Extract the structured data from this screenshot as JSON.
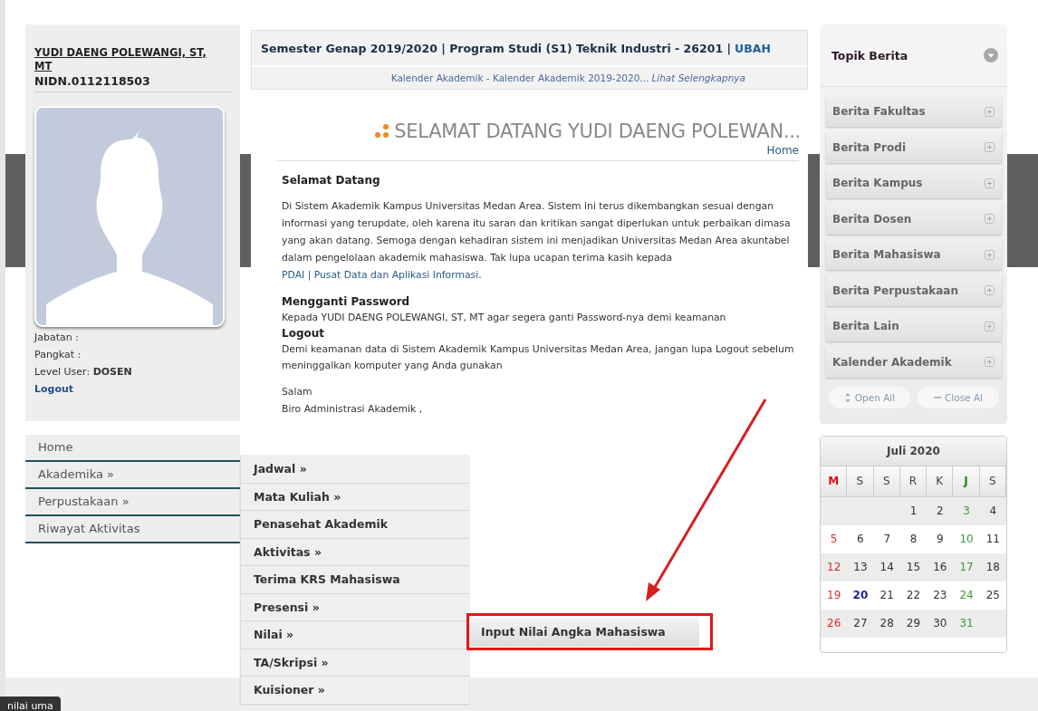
{
  "profile": {
    "name": "YUDI DAENG POLEWANGI, ST, MT",
    "nidn": "NIDN.0112118503",
    "info": [
      "Jabatan :",
      "Pangkat :",
      "Level User: **DOSEN**"
    ],
    "logout": "Logout"
  },
  "menu": [
    "Home",
    "Akademika »",
    "Perpustakaan »",
    "Riwayat Aktivitas"
  ],
  "submenu": [
    "Jadwal »",
    "Mata Kuliah »",
    "Penasehat Akademik",
    "Aktivitas »",
    "Terima KRS Mahasiswa",
    "Presensi »",
    "Nilai »",
    "TA/Skripsi »",
    "Kuisioner »"
  ],
  "flyout": {
    "label": "Input Nilai Angka Mahasiswa",
    "highlighted": true,
    "pointed": true
  },
  "header": {
    "info": "Semester Genap 2019/2020 | Program Studi (S1) Teknik Industri - 26201 |",
    "action": "UBAH",
    "announcement": "Kalender Akademik - Kalender Akademik 2019-2020...",
    "more": "Lihat Selengkapnya"
  },
  "welcome": {
    "title": "SELAMAT DATANG YUDI DAENG POLEWAN...",
    "breadcrumb": "Home",
    "sections": [
      {
        "heading": "Selamat Datang",
        "kind": "intro",
        "text": "Di Sistem Akademik Kampus Universitas Medan Area. Sistem ini terus dikembangkan sesuai dengan informasi yang terupdate, oleh karena itu saran dan kritikan sangat diperlukan untuk perbaikan dimasa yang akan datang. Semoga dengan kehadiran sistem ini menjadikan Universitas Medan Area akuntabel dalam pengelolaan akademik mahasiswa. Tak lupa ucapan terima kasih kepada",
        "link": "PDAI | Pusat Data dan Aplikasi Informasi",
        "end": "."
      },
      {
        "heading": "Mengganti Password",
        "kind": "note",
        "text": "Kepada YUDI DAENG POLEWANGI, ST, MT agar segera ganti Password-nya demi keamanan"
      },
      {
        "heading": "Logout",
        "kind": "note",
        "text": "Demi keamanan data di Sistem Akademik Kampus Universitas Medan Area, jangan lupa Logout sebelum meninggalkan komputer yang Anda gunakan"
      }
    ],
    "closing": [
      "Salam",
      "Biro Administrasi Akademik ,"
    ]
  },
  "news": {
    "title": "Topik Berita",
    "topics": [
      {
        "label": "Berita Fakultas",
        "expanded": false
      },
      {
        "label": "Berita Prodi",
        "expanded": false
      },
      {
        "label": "Berita Kampus",
        "expanded": false
      },
      {
        "label": "Berita Dosen",
        "expanded": false
      },
      {
        "label": "Berita Mahasiswa",
        "expanded": false
      },
      {
        "label": "Berita Perpustakaan",
        "expanded": false
      },
      {
        "label": "Berita Lain",
        "expanded": false
      },
      {
        "label": "Kalender Akademik",
        "expanded": false
      }
    ],
    "buttons": [
      {
        "kind": "open",
        "label": "Open All"
      },
      {
        "kind": "close",
        "label": "Close Al"
      }
    ]
  },
  "calendar": {
    "title": "Juli 2020",
    "weekdays": [
      {
        "label": "M",
        "kind": "sunday"
      },
      {
        "label": "S",
        "kind": "normal"
      },
      {
        "label": "S",
        "kind": "normal"
      },
      {
        "label": "R",
        "kind": "normal"
      },
      {
        "label": "K",
        "kind": "normal"
      },
      {
        "label": "J",
        "kind": "friday"
      },
      {
        "label": "S",
        "kind": "normal"
      }
    ],
    "weeks": [
      [
        {
          "kind": "empty"
        },
        {
          "kind": "empty"
        },
        {
          "kind": "empty"
        },
        {
          "day": "1",
          "kind": "normal"
        },
        {
          "day": "2",
          "kind": "normal"
        },
        {
          "day": "3",
          "kind": "friday"
        },
        {
          "day": "4",
          "kind": "normal"
        }
      ],
      [
        {
          "day": "5",
          "kind": "sunday"
        },
        {
          "day": "6",
          "kind": "normal"
        },
        {
          "day": "7",
          "kind": "normal"
        },
        {
          "day": "8",
          "kind": "normal"
        },
        {
          "day": "9",
          "kind": "normal"
        },
        {
          "day": "10",
          "kind": "friday"
        },
        {
          "day": "11",
          "kind": "normal"
        }
      ],
      [
        {
          "day": "12",
          "kind": "sunday"
        },
        {
          "day": "13",
          "kind": "normal"
        },
        {
          "day": "14",
          "kind": "normal"
        },
        {
          "day": "15",
          "kind": "normal"
        },
        {
          "day": "16",
          "kind": "normal"
        },
        {
          "day": "17",
          "kind": "friday"
        },
        {
          "day": "18",
          "kind": "normal"
        }
      ],
      [
        {
          "day": "19",
          "kind": "sunday"
        },
        {
          "day": "20",
          "kind": "today"
        },
        {
          "day": "21",
          "kind": "normal"
        },
        {
          "day": "22",
          "kind": "normal"
        },
        {
          "day": "23",
          "kind": "normal"
        },
        {
          "day": "24",
          "kind": "friday"
        },
        {
          "day": "25",
          "kind": "normal"
        }
      ],
      [
        {
          "day": "26",
          "kind": "sunday"
        },
        {
          "day": "27",
          "kind": "normal"
        },
        {
          "day": "28",
          "kind": "normal"
        },
        {
          "day": "29",
          "kind": "normal"
        },
        {
          "day": "30",
          "kind": "normal"
        },
        {
          "day": "31",
          "kind": "friday"
        },
        {
          "kind": "empty"
        }
      ]
    ]
  },
  "tooltip": "nilai uma"
}
